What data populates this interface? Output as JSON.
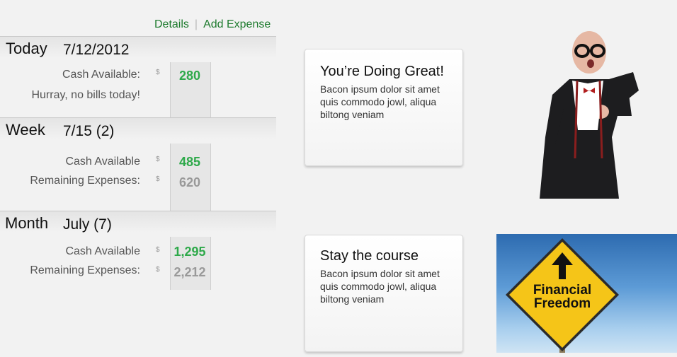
{
  "nav": {
    "details": "Details",
    "separator": "|",
    "add_expense": "Add Expense"
  },
  "today": {
    "title": "Today",
    "date": "7/12/2012",
    "cash_label": "Cash Available:",
    "cash_value": "280",
    "currency": "$",
    "message": "Hurray, no bills today!"
  },
  "week": {
    "title": "Week",
    "range": "7/15 (2)",
    "cash_label": "Cash Available",
    "cash_value": "485",
    "remaining_label": "Remaining Expenses:",
    "remaining_value": "620",
    "currency": "$"
  },
  "month": {
    "title": "Month",
    "range": "July (7)",
    "cash_label": "Cash Available",
    "cash_value": "1,295",
    "remaining_label": "Remaining Expenses:",
    "remaining_value": "2,212",
    "currency": "$"
  },
  "cards": [
    {
      "title": "You’re Doing Great!",
      "body": "Bacon ipsum dolor sit amet quis commodo jowl, aliqua biltong veniam"
    },
    {
      "title": "Stay the course",
      "body": "Bacon ipsum dolor sit amet quis commodo jowl, aliqua biltong veniam"
    }
  ],
  "sign": {
    "line1": "Financial",
    "line2": "Freedom"
  },
  "colors": {
    "accent_green": "#2ea94a",
    "link_green": "#1e7b2e",
    "sign_yellow": "#f5c518",
    "sky_blue": "#3a78bd"
  }
}
